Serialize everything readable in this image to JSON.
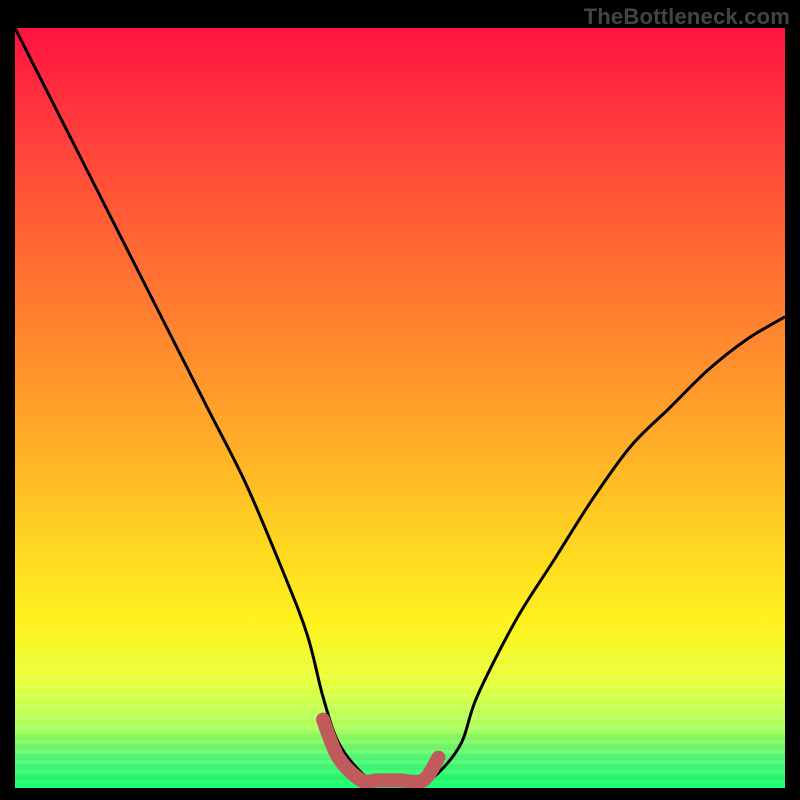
{
  "watermark": "TheBottleneck.com",
  "colors": {
    "background": "#000000",
    "curve_stroke": "#000000",
    "bottom_accent": "#c15a5a",
    "watermark_text": "#444444"
  },
  "chart_data": {
    "type": "line",
    "title": "",
    "xlabel": "",
    "ylabel": "",
    "xlim": [
      0,
      100
    ],
    "ylim": [
      0,
      100
    ],
    "grid": false,
    "legend": false,
    "note": "No numeric axis labels are visible in the image; values are estimated from pixel proportions as percentages.",
    "series": [
      {
        "name": "curve",
        "x": [
          0,
          5,
          10,
          15,
          20,
          25,
          30,
          35,
          38,
          40,
          42,
          45,
          47,
          50,
          53,
          55,
          58,
          60,
          65,
          70,
          75,
          80,
          85,
          90,
          95,
          100
        ],
        "y": [
          100,
          90,
          80,
          70,
          60,
          50,
          40,
          28,
          20,
          12,
          6,
          2,
          1,
          1,
          1,
          2,
          6,
          12,
          22,
          30,
          38,
          45,
          50,
          55,
          59,
          62
        ]
      },
      {
        "name": "bottom-accent",
        "x": [
          40,
          42,
          45,
          47,
          50,
          53,
          55
        ],
        "y": [
          9,
          4,
          1,
          1,
          1,
          1,
          4
        ]
      }
    ]
  }
}
